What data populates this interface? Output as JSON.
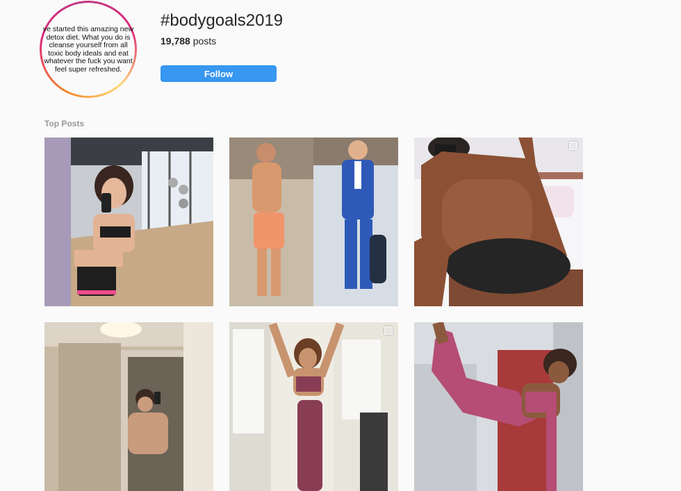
{
  "profile": {
    "avatar_text": "ve started this amazing new detox diet. What you do is cleanse yourself from all toxic body ideals and eat whatever the fuck you want feel super refreshed.",
    "hashtag": "#bodygoals2019",
    "post_count": "19,788",
    "post_count_suffix": "posts",
    "follow_label": "Follow"
  },
  "sections": {
    "top_posts_label": "Top Posts"
  },
  "posts": [
    {
      "id": "gym-mirror-selfie",
      "multi": false
    },
    {
      "id": "men-split-photo",
      "multi": false
    },
    {
      "id": "back-flex-photo",
      "multi": true
    },
    {
      "id": "bathroom-mirror-selfie",
      "multi": false
    },
    {
      "id": "stretch-pose-photo",
      "multi": true
    },
    {
      "id": "kick-pose-photo",
      "multi": false
    }
  ],
  "colors": {
    "background": "#fafafa",
    "follow_button": "#3897f0",
    "ring_gradient": [
      "#f58529",
      "#dd2a7b",
      "#c13584",
      "#feda75"
    ]
  }
}
